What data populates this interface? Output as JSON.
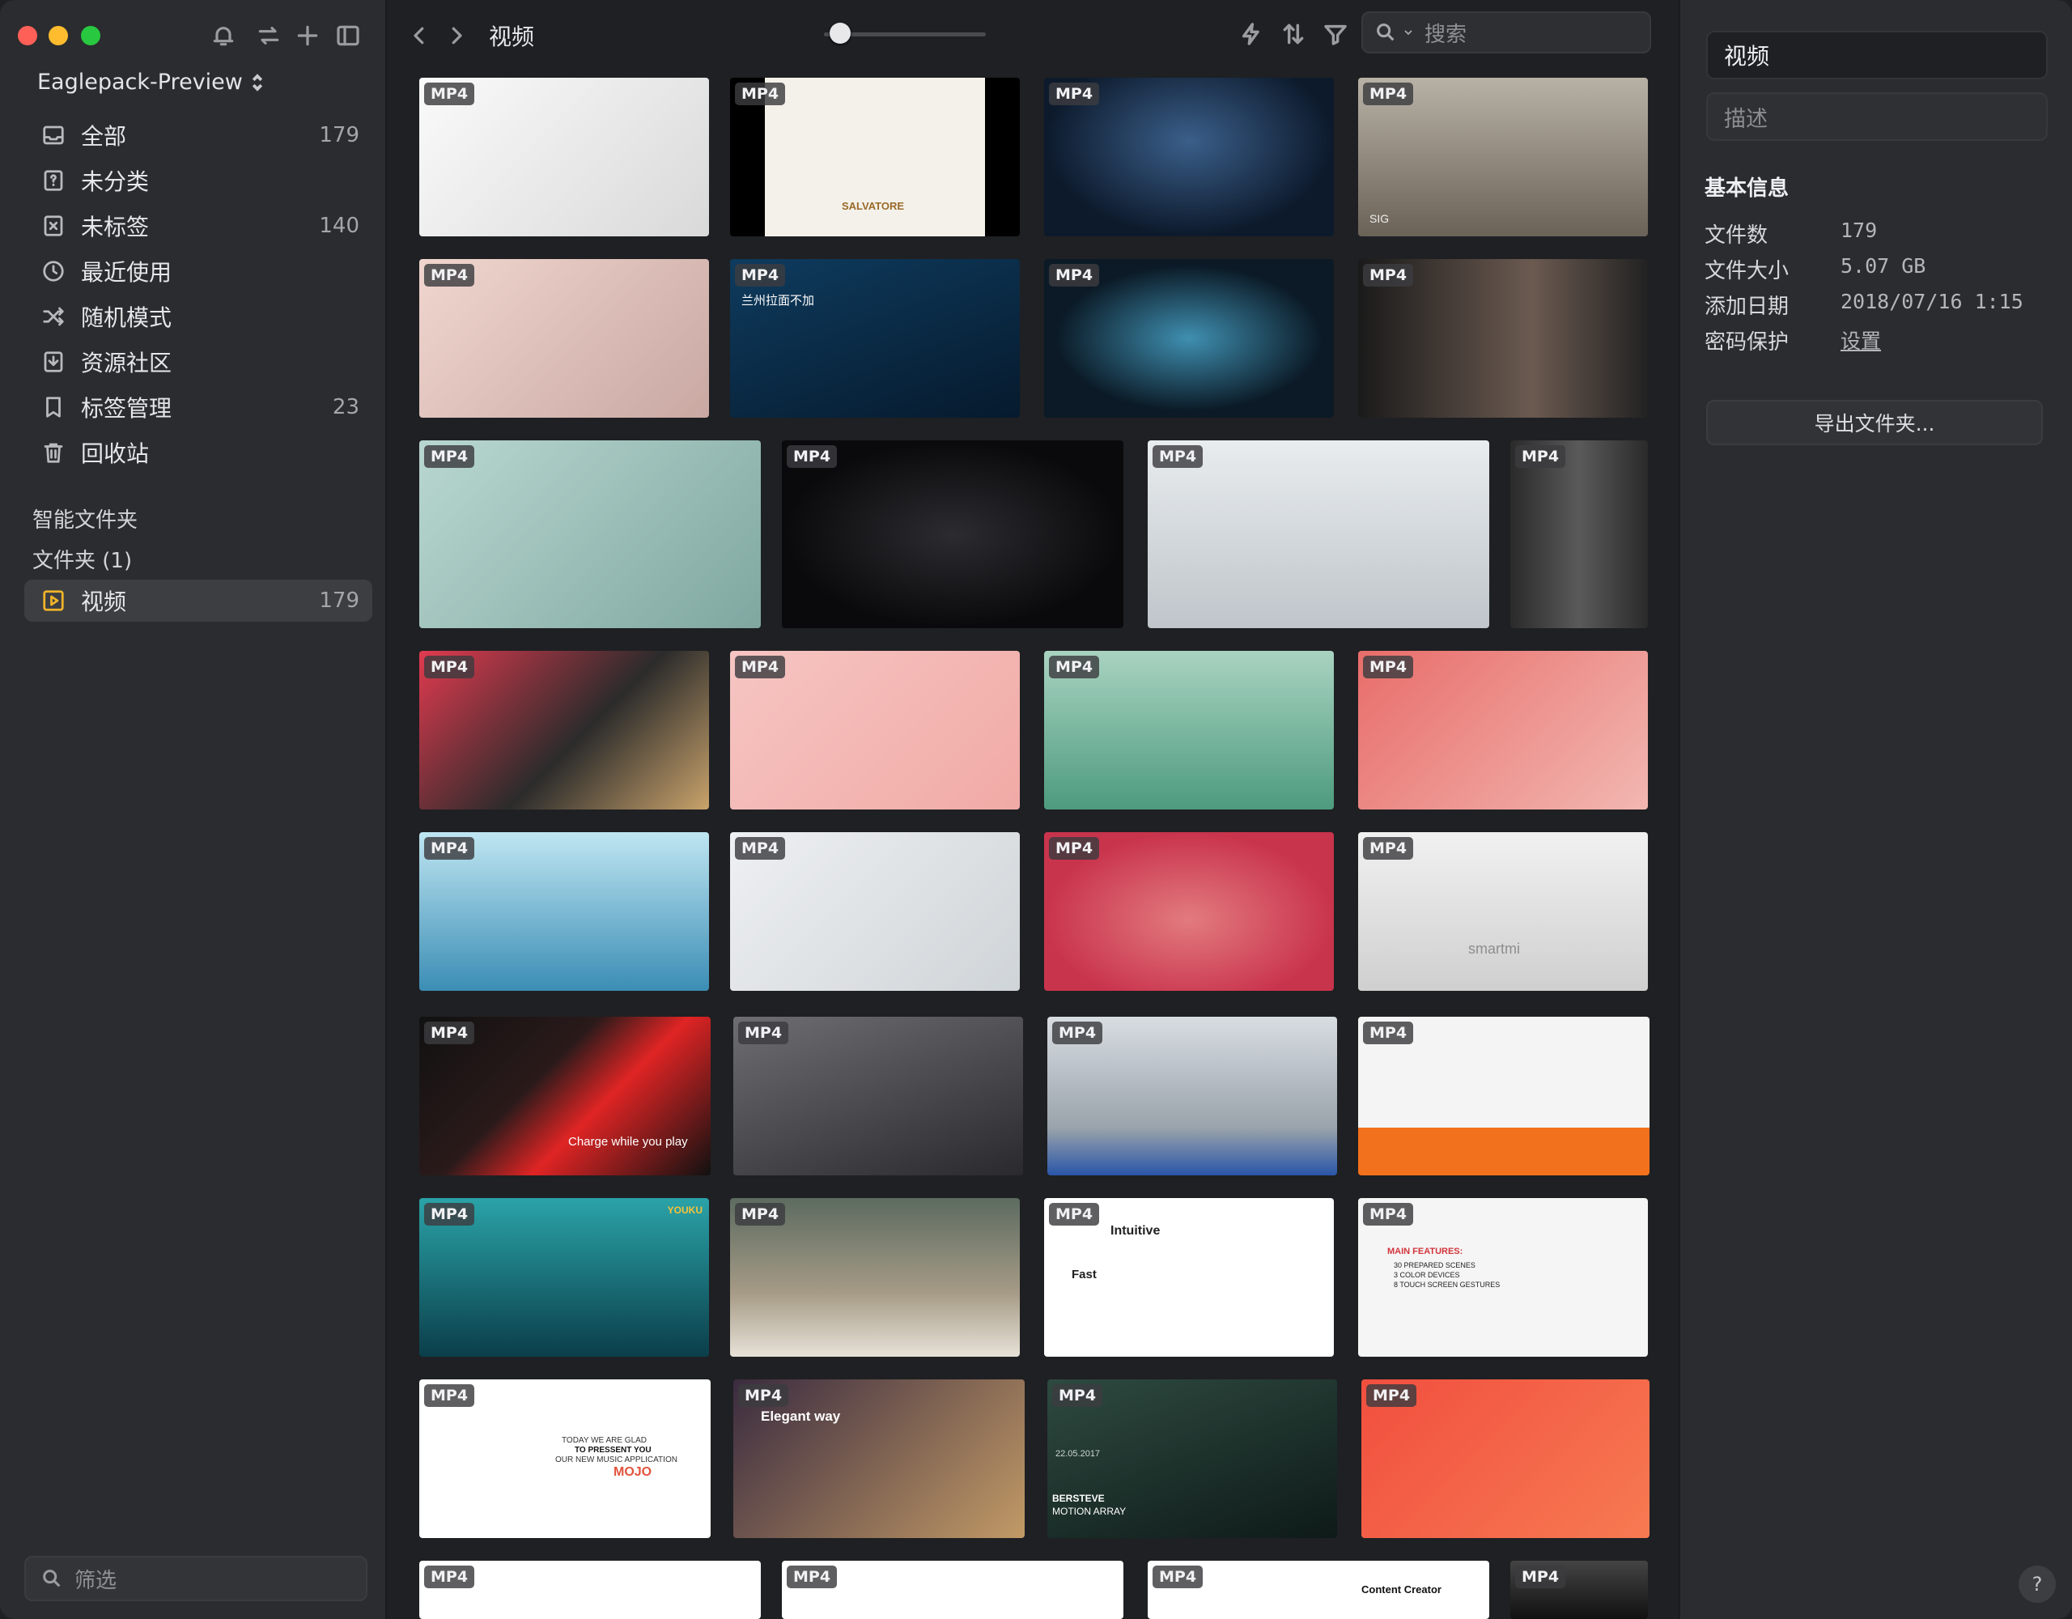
{
  "library": {
    "name": "Eaglepack-Preview"
  },
  "nav": [
    {
      "label": "全部",
      "count": "179",
      "icon": "inbox-icon"
    },
    {
      "label": "未分类",
      "count": "",
      "icon": "unsorted-icon"
    },
    {
      "label": "未标签",
      "count": "140",
      "icon": "untagged-icon"
    },
    {
      "label": "最近使用",
      "count": "",
      "icon": "clock-icon"
    },
    {
      "label": "随机模式",
      "count": "",
      "icon": "shuffle-icon"
    },
    {
      "label": "资源社区",
      "count": "",
      "icon": "download-icon"
    },
    {
      "label": "标签管理",
      "count": "23",
      "icon": "bookmark-icon"
    },
    {
      "label": "回收站",
      "count": "",
      "icon": "trash-icon"
    }
  ],
  "smart_folders": {
    "title": "智能文件夹"
  },
  "folders": {
    "title": "文件夹 (1)",
    "items": [
      {
        "label": "视频",
        "count": "179",
        "icon": "video-folder-icon"
      }
    ]
  },
  "filter": {
    "placeholder": "筛选"
  },
  "toolbar": {
    "breadcrumb": "视频",
    "search_placeholder": "搜索",
    "zoom_level": 0.1
  },
  "thumbnails": {
    "badge": "MP4",
    "captions": {
      "t2": "SALVATORE",
      "t4": "SIG",
      "t6": "兰州拉面不加",
      "t25": "Charge while you play",
      "t29": "YOUKU",
      "t31a": "Intuitive",
      "t31b": "Fast",
      "t32": "MAIN FEATURES:",
      "t32b": "30 PREPARED SCENES",
      "t32c": "3 COLOR DEVICES",
      "t32d": "8 TOUCH SCREEN GESTURES",
      "t33a": "TODAY WE ARE GLAD",
      "t33b": "TO PRESSENT YOU",
      "t33c": "OUR NEW MUSIC APPLICATION",
      "t33d": "MOJO",
      "t34": "Elegant way",
      "t35a": "22.05.2017",
      "t35b": "BERSTEVE",
      "t35c": "MOTION ARRAY",
      "t20": "smartmi",
      "t39": "Content Creator"
    }
  },
  "inspector": {
    "title": "视频",
    "description_placeholder": "描述",
    "section": "基本信息",
    "rows": [
      {
        "key": "文件数",
        "value": "179"
      },
      {
        "key": "文件大小",
        "value": "5.07 GB"
      },
      {
        "key": "添加日期",
        "value": "2018/07/16 1:15"
      },
      {
        "key": "密码保护",
        "value": "设置"
      }
    ],
    "export_label": "导出文件夹...",
    "help_label": "?"
  },
  "colors": {
    "accent": "#f0b429",
    "sidebar_bg": "#2b2c2f",
    "main_bg": "#1f2023"
  }
}
